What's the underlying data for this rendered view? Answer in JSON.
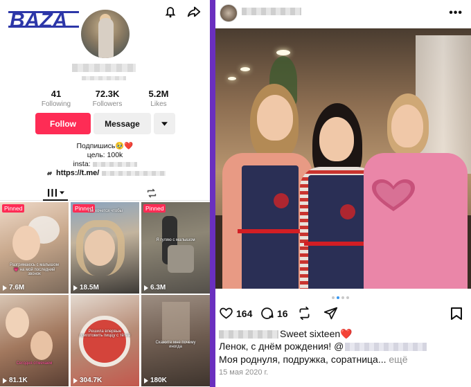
{
  "tiktok": {
    "logo_text": "BAZA",
    "stats": [
      {
        "value": "41",
        "label": "Following"
      },
      {
        "value": "72.3K",
        "label": "Followers"
      },
      {
        "value": "5.2M",
        "label": "Likes"
      }
    ],
    "follow_label": "Follow",
    "message_label": "Message",
    "bio": {
      "line1": "Подпишись🥹❤️",
      "line2": "цель: 100k",
      "line3": "insta:",
      "link_prefix": "https://t.me/"
    },
    "videos": [
      {
        "badge": "Pinned",
        "views": "7.6M",
        "caption": "Разгримаюсь с малышом 💗 на мой последний звонок"
      },
      {
        "badge": "Pinned",
        "views": "18.5M",
        "caption": "Так хочется чтобы"
      },
      {
        "badge": "Pinned",
        "views": "6.3M",
        "caption": "Я гуляю с малышом"
      },
      {
        "badge": "",
        "views": "81.1K",
        "caption": "Сегодня отмечаем"
      },
      {
        "badge": "",
        "views": "304.7K",
        "caption": "Решила впервые приготовить пиццу с тётей"
      },
      {
        "badge": "",
        "views": "180K",
        "caption": "Скажите мне почему иногда"
      }
    ]
  },
  "instagram": {
    "likes": "164",
    "comments": "16",
    "caption_line1": "Sweet sixteen❤️",
    "caption_line2": "Ленок, с днём рождения! @",
    "caption_line3": "Моя роднуля, подружка, соратница...",
    "more": "ещё",
    "date": "15 мая 2020 г.",
    "carousel_dots": 4,
    "carousel_active": 2
  },
  "colors": {
    "tiktok_red": "#fe2c55",
    "divider_purple": "#6a2fbf",
    "ig_mention": "#1c4b8a",
    "ig_blue_dot": "#3897f0"
  }
}
